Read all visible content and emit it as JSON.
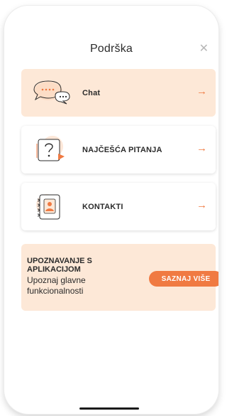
{
  "header": {
    "title": "Podrška",
    "close_icon": "close-icon",
    "close_glyph": "✕"
  },
  "cards": [
    {
      "label": "Chat",
      "icon": "chat-icon",
      "arrow": "→",
      "style": "peach"
    },
    {
      "label": "NAJČEŠĆA PITANJA",
      "icon": "question-icon",
      "arrow": "→",
      "style": "white"
    },
    {
      "label": "KONTAKTI",
      "icon": "contacts-book-icon",
      "arrow": "→",
      "style": "white"
    }
  ],
  "promo": {
    "title": "UPOZNAVANJE S APLIKACIJOM",
    "description": "Upoznaj glavne funkcionalnosti",
    "button_label": "SAZNAJ VIŠE"
  },
  "colors": {
    "accent": "#f07a42",
    "peach_bg": "#fde8d7",
    "text": "#2b2b2b"
  }
}
